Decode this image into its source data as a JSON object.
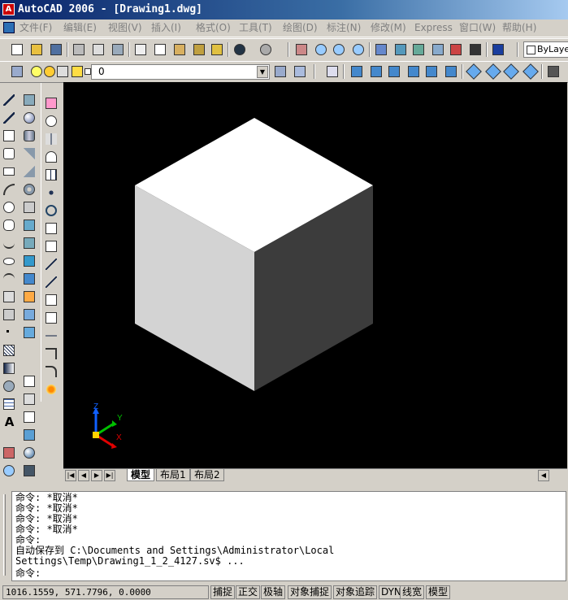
{
  "window": {
    "title": "AutoCAD 2006 - [Drawing1.dwg]"
  },
  "menu": {
    "items": [
      "文件(F)",
      "编辑(E)",
      "视图(V)",
      "插入(I)",
      "格式(O)",
      "工具(T)",
      "绘图(D)",
      "标注(N)",
      "修改(M)",
      "Express",
      "窗口(W)",
      "帮助(H)"
    ]
  },
  "toolbar": {
    "color_control": "ByLayer",
    "layer_value": "0"
  },
  "layout_tabs": [
    "模型",
    "布局1",
    "布局2"
  ],
  "ucs": {
    "x": "X",
    "y": "Y",
    "z": "Z"
  },
  "command_lines": [
    "命令: *取消*",
    "命令: *取消*",
    "命令: *取消*",
    "命令: *取消*",
    "命令:",
    "自动保存到 C:\\Documents and Settings\\Administrator\\Local",
    "Settings\\Temp\\Drawing1_1_2_4127.sv$ ...",
    "命令:"
  ],
  "status": {
    "coordinates": "1016.1559, 571.7796, 0.0000",
    "buttons": [
      "捕捉",
      "正交",
      "极轴",
      "对象捕捉",
      "对象追踪",
      "DYN",
      "线宽",
      "模型"
    ]
  },
  "colors": {
    "title_start": "#0a246a",
    "title_end": "#a6caf0",
    "canvas_bg": "#000000",
    "cube_top": "#ffffff",
    "cube_left": "#d3d3d3",
    "cube_right": "#3c3c3c",
    "ucs_x": "#e00000",
    "ucs_y": "#00c000",
    "ucs_z": "#1060ff"
  }
}
